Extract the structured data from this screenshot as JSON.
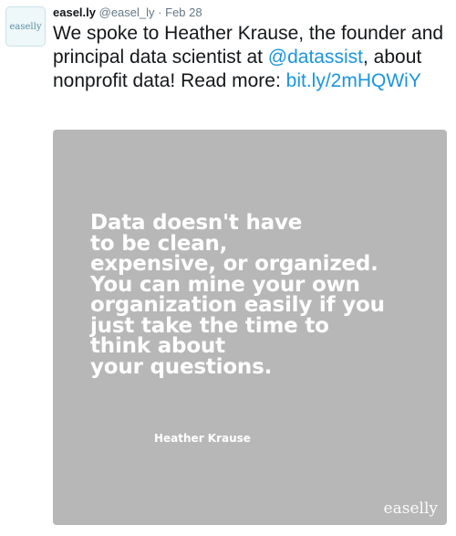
{
  "tweet": {
    "avatar_text": "easelly",
    "display_name": "easel.ly",
    "handle": "@easel_ly",
    "separator": "·",
    "date": "Feb 28",
    "text_part1": "We spoke to Heather Krause, the founder and principal data scientist at ",
    "mention": "@datassist",
    "text_part2": ", about nonprofit data! Read more: ",
    "link": "bit.ly/2mHQWiY"
  },
  "media": {
    "quote": "Data doesn't have\nto be clean,\nexpensive, or organized.\nYou can mine your own\norganization easily if you\njust take the time to\nthink about\nyour questions.",
    "author": "Heather Krause",
    "watermark": "easelly",
    "background_color": "#b7b7b7"
  },
  "colors": {
    "link": "#1b95e0",
    "text": "#14171a",
    "muted": "#657786"
  }
}
